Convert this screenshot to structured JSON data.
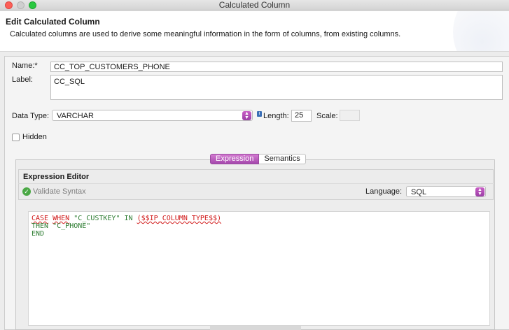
{
  "window": {
    "title": "Calculated Column"
  },
  "header": {
    "title": "Edit Calculated Column",
    "description": "Calculated columns are used to derive some meaningful information in the form of columns, from existing columns."
  },
  "form": {
    "name_label": "Name:*",
    "name_value": "CC_TOP_CUSTOMERS_PHONE",
    "label_label": "Label:",
    "label_value": "CC_SQL",
    "datatype_label": "Data Type:",
    "datatype_value": "VARCHAR",
    "length_label": "Length:",
    "length_value": "25",
    "scale_label": "Scale:",
    "scale_value": "",
    "hidden_label": "Hidden",
    "hidden_checked": false
  },
  "tabs": [
    {
      "label": "Expression",
      "active": true
    },
    {
      "label": "Semantics",
      "active": false
    }
  ],
  "editor": {
    "title": "Expression Editor",
    "validate_label": "Validate Syntax",
    "language_label": "Language:",
    "language_value": "SQL",
    "code": {
      "line1_kw1": "CASE",
      "line1_kw2": "WHEN",
      "line1_str": "\"C_CUSTKEY\"",
      "line1_kw3": "IN",
      "line1_rest": "($$IP_COLUMN_TYPE$$)",
      "line2_kw": "THEN",
      "line2_str": "\"C_PHONE\"",
      "line3_kw": "END"
    }
  }
}
